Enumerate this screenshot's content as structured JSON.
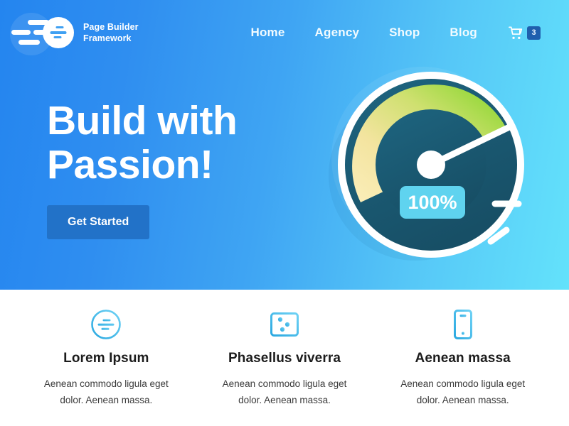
{
  "brand": {
    "name": "Page Builder\nFramework",
    "logo_icon": "page-builder-logo-icon"
  },
  "nav": {
    "items": [
      {
        "label": "Home"
      },
      {
        "label": "Agency"
      },
      {
        "label": "Shop"
      },
      {
        "label": "Blog"
      }
    ],
    "cart": {
      "icon": "shopping-cart-icon",
      "count": "3"
    }
  },
  "hero": {
    "title": "Build with\nPassion!",
    "cta_label": "Get Started",
    "gradient_from": "#2485ef",
    "gradient_to": "#63e2fb",
    "cta_color": "#2272c8"
  },
  "illustration": {
    "name": "speedometer-gauge",
    "value_badge": "100%",
    "face_color": "#1d5a72",
    "arc_from": "#f6e4a8",
    "arc_to": "#84d62b",
    "badge_color": "#5fd3ef",
    "needle_color": "#ffffff"
  },
  "features": {
    "items": [
      {
        "icon": "page-builder-logo-icon",
        "title": "Lorem Ipsum",
        "text": "Aenean commodo ligula eget dolor. Aenean massa."
      },
      {
        "icon": "sliders-panel-icon",
        "title": "Phasellus viverra",
        "text": "Aenean commodo ligula eget dolor. Aenean massa."
      },
      {
        "icon": "mobile-device-icon",
        "title": "Aenean massa",
        "text": "Aenean commodo ligula eget dolor. Aenean massa."
      }
    ],
    "icon_color_from": "#2aa8e0",
    "icon_color_to": "#5fc9f2"
  }
}
